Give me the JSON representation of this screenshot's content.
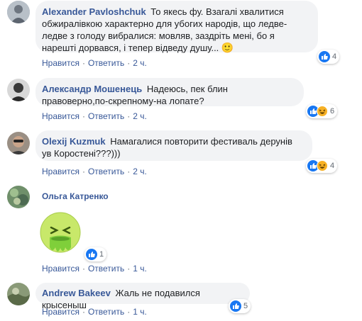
{
  "actions": {
    "like": "Нравится",
    "reply": "Ответить"
  },
  "comments": [
    {
      "author": "Alexander Pavloshchuk",
      "text": "То якесь фу. Взагалі хвалитися обжиралівкою характерно для убогих народів, що ледве-ледве з голоду вибралися: мовляв, заздріть мені, бо я нарешті дорвався, і тепер відведу душу...",
      "emoji": "🙂",
      "time": "2 ч.",
      "reactions": "4"
    },
    {
      "author": "Александр Мошенець",
      "text": "Надеюсь, пек блин правоверно,по-скрепному-на лопате?",
      "time": "2 ч.",
      "reactions": "6"
    },
    {
      "author": "Olexij Kuzmuk",
      "text": "Намагалися повторити фестиваль дерунів ув Коростені???)))",
      "time": "2 ч.",
      "reactions": "4"
    },
    {
      "author": "Ольга Катренко",
      "time": "1 ч.",
      "reactions": "1"
    },
    {
      "author": "Andrew Bakeev",
      "text": "Жаль не подавился крысеныш",
      "time": "1 ч.",
      "reactions": "5"
    }
  ],
  "colors": {
    "link": "#385898",
    "bubble": "#f2f3f5",
    "like_blue": "#1877f2",
    "haha_yellow": "#f7b125"
  },
  "icons": [
    "like-icon",
    "haha-icon",
    "smile-emoji-icon",
    "sick-sticker-icon"
  ]
}
